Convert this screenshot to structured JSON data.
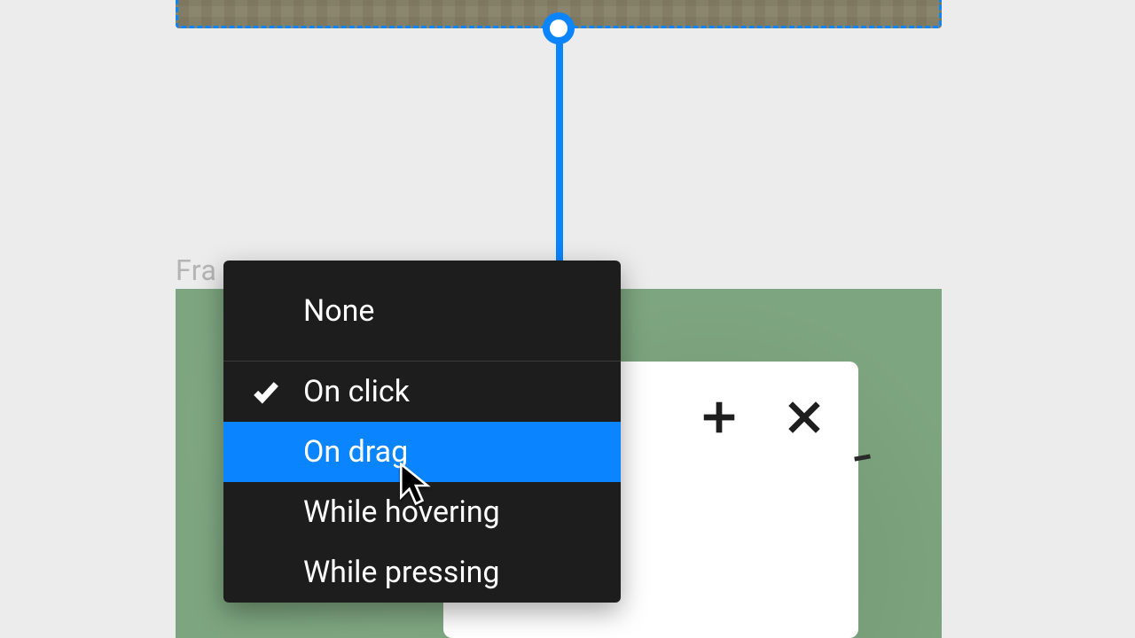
{
  "frame_label": "Fra",
  "menu": {
    "header": "None",
    "items": [
      {
        "label": "On click",
        "checked": true,
        "highlight": false
      },
      {
        "label": "On drag",
        "checked": false,
        "highlight": true
      },
      {
        "label": "While hovering",
        "checked": false,
        "highlight": false
      },
      {
        "label": "While pressing",
        "checked": false,
        "highlight": false
      }
    ]
  },
  "colors": {
    "accent": "#0a84ff",
    "menu_bg": "#1d1d1d",
    "canvas_bg": "#ececec",
    "target_frame_bg": "#7da57f"
  },
  "icons": {
    "plus": "plus-icon",
    "close": "close-icon",
    "check": "check-icon"
  }
}
